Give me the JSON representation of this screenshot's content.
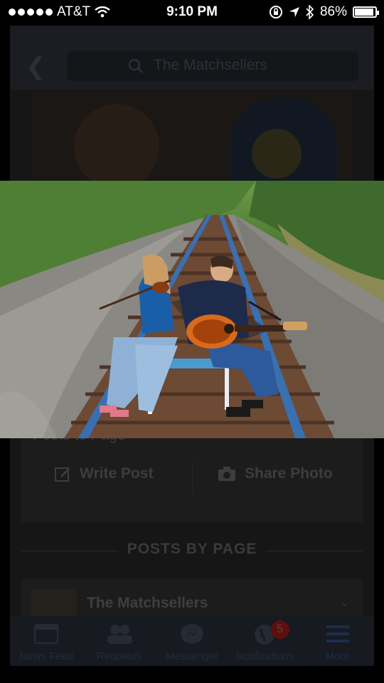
{
  "status": {
    "carrier": "AT&T",
    "time": "9:10 PM",
    "battery": "86%",
    "battery_level": 0.86
  },
  "header": {
    "search_text": "The Matchsellers"
  },
  "composer": {
    "title": "Posts to Page",
    "write_post": "Write Post",
    "share_photo": "Share Photo"
  },
  "section": {
    "label": "POSTS BY PAGE"
  },
  "post": {
    "page_name": "The Matchsellers"
  },
  "tabs": [
    {
      "label": "News Feed",
      "icon": "news-feed-icon"
    },
    {
      "label": "Requests",
      "icon": "requests-icon"
    },
    {
      "label": "Messenger",
      "icon": "messenger-icon"
    },
    {
      "label": "Notifications",
      "icon": "globe-icon",
      "badge": "5"
    },
    {
      "label": "More",
      "icon": "menu-icon"
    }
  ],
  "colors": {
    "accent": "#3b5998",
    "badge": "#e0352b"
  }
}
